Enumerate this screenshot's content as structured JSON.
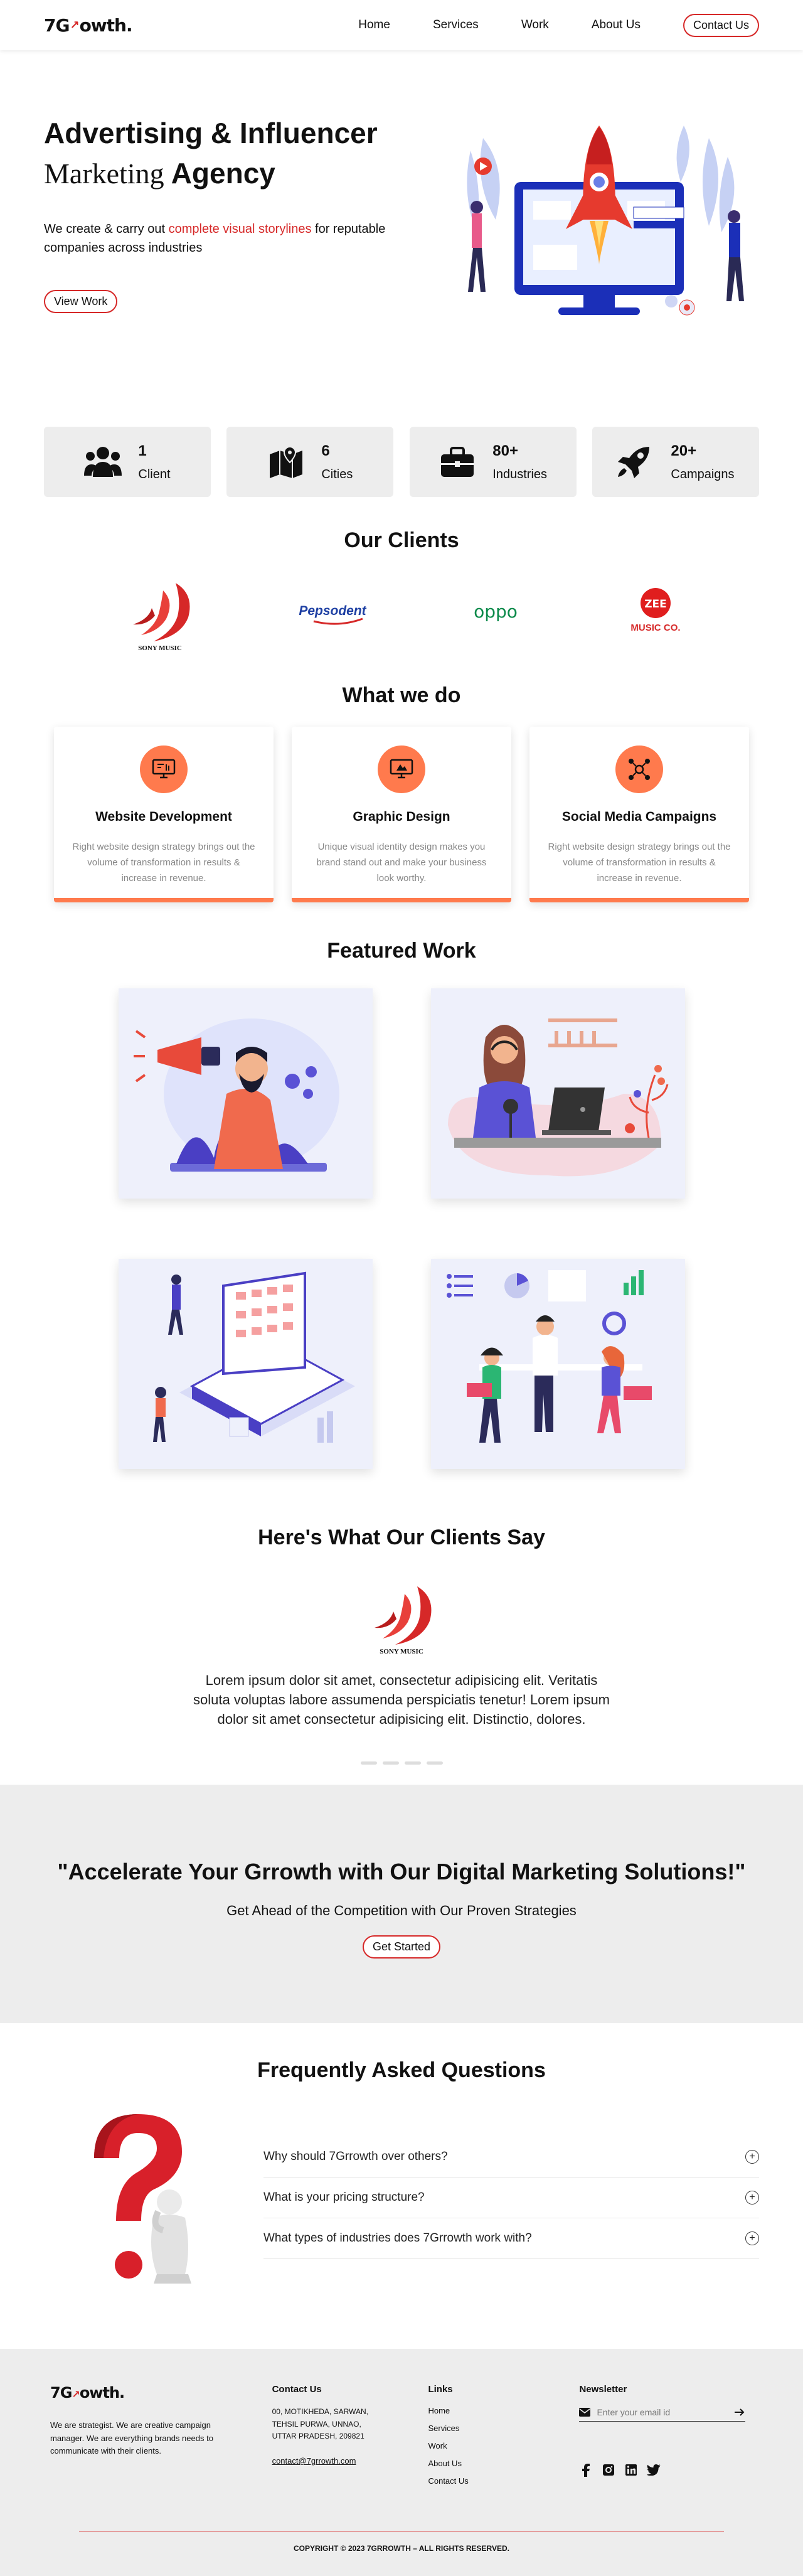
{
  "header": {
    "logo": {
      "prefix": "7G",
      "suffix": "owth."
    },
    "nav": [
      "Home",
      "Services",
      "Work",
      "About Us"
    ],
    "contact_label": "Contact Us"
  },
  "hero": {
    "title_line1": "Advertising & Influencer",
    "title_line2_serif": "Marketing",
    "title_line2_bold": "Agency",
    "desc_before": "We create & carry out ",
    "desc_accent": "complete visual storylines",
    "desc_after": " for reputable companies across industries",
    "button_label": "View Work"
  },
  "stats": [
    {
      "icon": "users-icon",
      "value": "1",
      "label": "Client"
    },
    {
      "icon": "map-icon",
      "value": "6",
      "label": "Cities"
    },
    {
      "icon": "briefcase-icon",
      "value": "80+",
      "label": "Industries"
    },
    {
      "icon": "rocket-icon",
      "value": "20+",
      "label": "Campaigns"
    }
  ],
  "clients": {
    "title": "Our Clients",
    "logos": [
      {
        "name": "sony-music",
        "text": "SONY MUSIC"
      },
      {
        "name": "pepsodent",
        "text": "Pepsodent"
      },
      {
        "name": "oppo",
        "text": "oppo"
      },
      {
        "name": "zee-music",
        "text_top": "ZEE",
        "text_bottom": "MUSIC CO."
      }
    ]
  },
  "services": {
    "title": "What we do",
    "items": [
      {
        "title": "Website Development",
        "desc": "Right website design strategy brings out the volume of transformation in results & increase in revenue."
      },
      {
        "title": "Graphic Design",
        "desc": "Unique visual identity design makes you brand stand out and make your business look worthy."
      },
      {
        "title": "Social Media Campaigns",
        "desc": "Right website design strategy brings out the volume of transformation in results & increase in revenue."
      }
    ]
  },
  "featured": {
    "title": "Featured Work"
  },
  "testimonials": {
    "title": "Here's What Our Clients Say",
    "logo_text": "SONY MUSIC",
    "quote": "Lorem ipsum dolor sit amet, consectetur adipisicing elit. Veritatis soluta voluptas labore assumenda perspiciatis tenetur! Lorem ipsum dolor sit amet consectetur adipisicing elit. Distinctio, dolores."
  },
  "cta": {
    "title": "\"Accelerate Your Grrowth with Our Digital Marketing Solutions!\"",
    "subtitle": "Get Ahead of the Competition with Our Proven Strategies",
    "button_label": "Get Started"
  },
  "faq": {
    "title": "Frequently Asked Questions",
    "items": [
      "Why should 7Grrowth over others?",
      "What is your pricing structure?",
      "What types of industries does 7Grrowth work with?"
    ]
  },
  "footer": {
    "about": "We are strategist. We are creative campaign manager. We are everything brands needs to communicate with their clients.",
    "contact_heading": "Contact Us",
    "address": "00, MOTIKHEDA, SARWAN, TEHSIL PURWA, UNNAO, UTTAR PRADESH, 209821",
    "email": "contact@7grrowth.com",
    "links_heading": "Links",
    "links": [
      "Home",
      "Services",
      "Work",
      "About Us",
      "Contact Us"
    ],
    "newsletter_heading": "Newsletter",
    "newsletter_placeholder": "Enter your email id",
    "socials": [
      "facebook-icon",
      "instagram-icon",
      "linkedin-icon",
      "twitter-icon"
    ],
    "copyright": "COPYRIGHT © 2023 7GRROWTH – ALL RIGHTS RESERVED."
  },
  "colors": {
    "accent_red": "#d62828",
    "accent_orange": "#ff7a4d",
    "panel_gray": "#ededed"
  }
}
